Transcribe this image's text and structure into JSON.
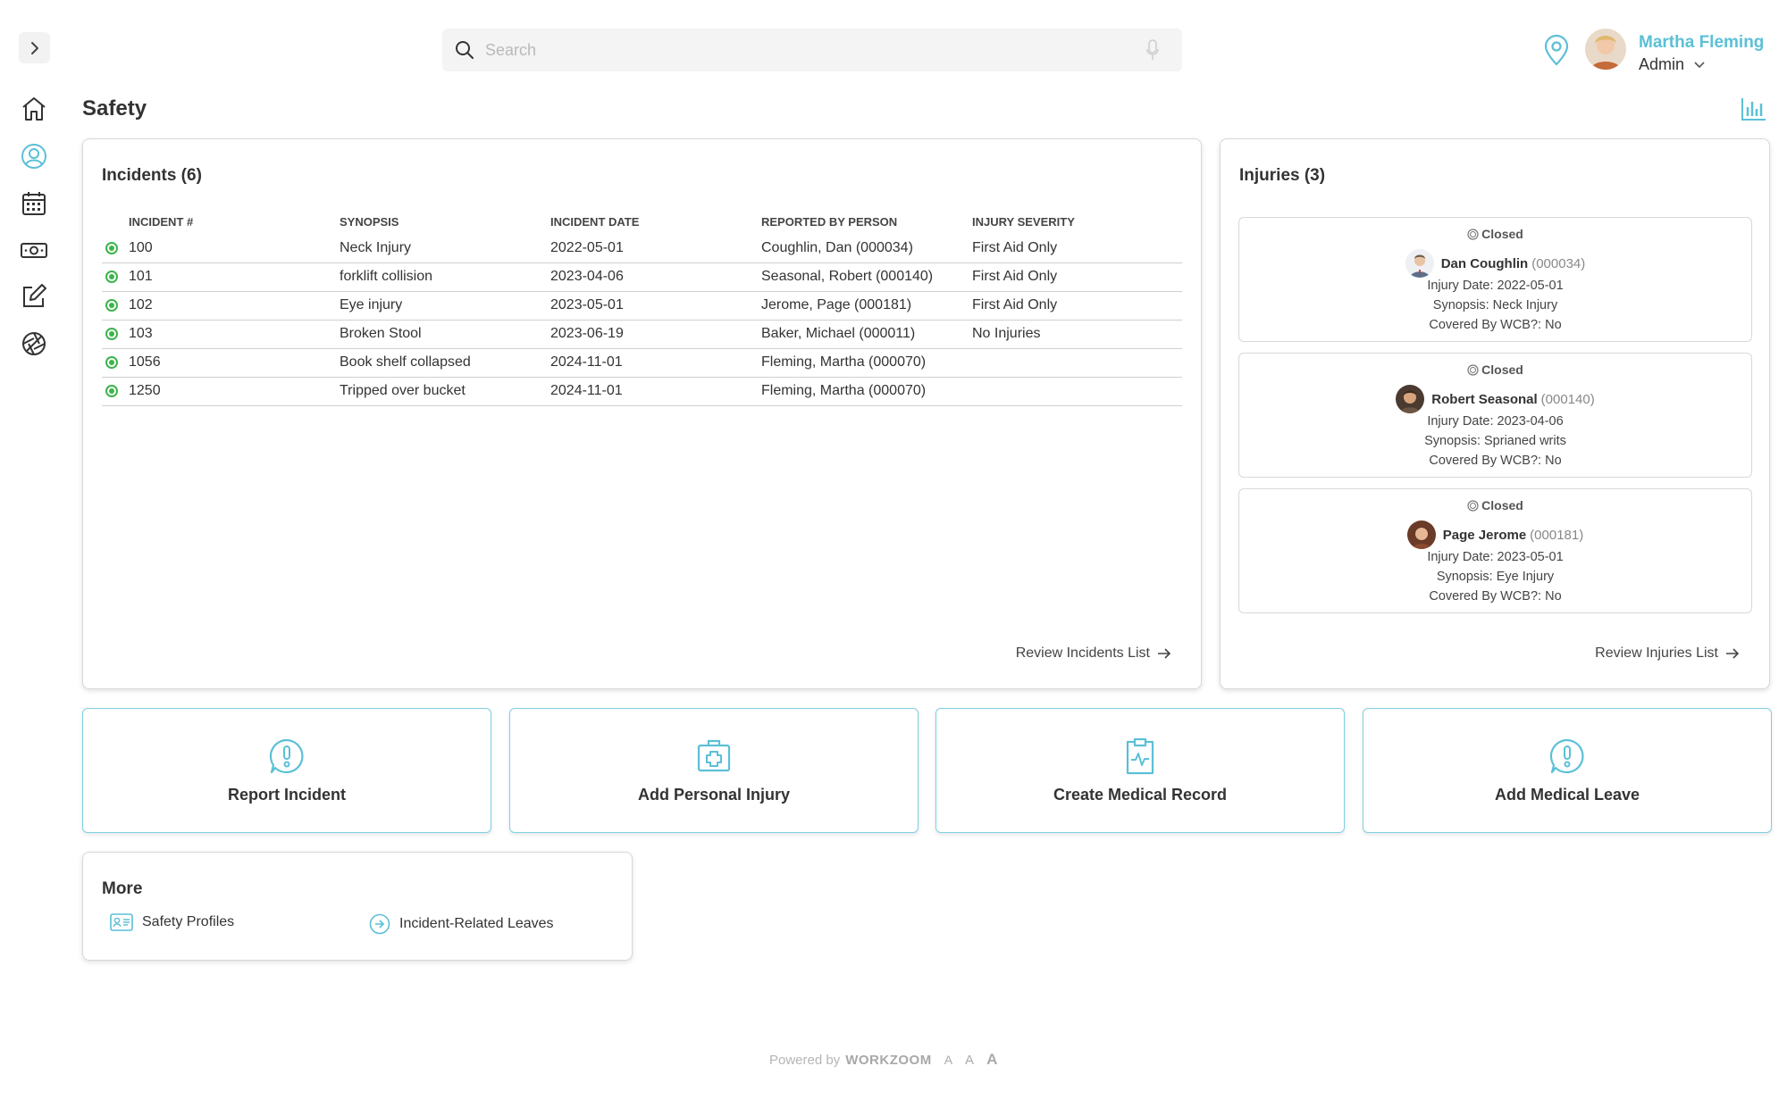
{
  "header": {
    "search_placeholder": "Search",
    "user_name": "Martha Fleming",
    "user_role": "Admin"
  },
  "page": {
    "title": "Safety"
  },
  "incidents": {
    "title": "Incidents (6)",
    "columns": [
      "INCIDENT #",
      "SYNOPSIS",
      "INCIDENT DATE",
      "REPORTED BY PERSON",
      "INJURY SEVERITY"
    ],
    "rows": [
      {
        "num": "100",
        "synopsis": "Neck Injury",
        "date": "2022-05-01",
        "reporter": "Coughlin, Dan (000034)",
        "severity": "First Aid Only"
      },
      {
        "num": "101",
        "synopsis": "forklift collision",
        "date": "2023-04-06",
        "reporter": "Seasonal, Robert (000140)",
        "severity": "First Aid Only"
      },
      {
        "num": "102",
        "synopsis": "Eye injury",
        "date": "2023-05-01",
        "reporter": "Jerome, Page (000181)",
        "severity": "First Aid Only"
      },
      {
        "num": "103",
        "synopsis": "Broken Stool",
        "date": "2023-06-19",
        "reporter": "Baker, Michael (000011)",
        "severity": "No Injuries"
      },
      {
        "num": "1056",
        "synopsis": "Book shelf collapsed",
        "date": "2024-11-01",
        "reporter": "Fleming, Martha (000070)",
        "severity": ""
      },
      {
        "num": "1250",
        "synopsis": "Tripped over bucket",
        "date": "2024-11-01",
        "reporter": "Fleming, Martha (000070)",
        "severity": ""
      }
    ],
    "review_link": "Review Incidents List"
  },
  "injuries": {
    "title": "Injuries (3)",
    "cards": [
      {
        "status": "Closed",
        "name": "Dan Coughlin",
        "id": "(000034)",
        "date": "Injury Date: 2022-05-01",
        "synopsis": "Synopsis: Neck Injury",
        "wcb": "Covered By WCB?: No"
      },
      {
        "status": "Closed",
        "name": "Robert Seasonal",
        "id": "(000140)",
        "date": "Injury Date: 2023-04-06",
        "synopsis": "Synopsis: Sprianed writs",
        "wcb": "Covered By WCB?: No"
      },
      {
        "status": "Closed",
        "name": "Page Jerome",
        "id": "(000181)",
        "date": "Injury Date: 2023-05-01",
        "synopsis": "Synopsis: Eye Injury",
        "wcb": "Covered By WCB?: No"
      }
    ],
    "review_link": "Review Injuries List"
  },
  "actions": [
    {
      "label": "Report Incident",
      "icon": "alert-bubble-icon"
    },
    {
      "label": "Add Personal Injury",
      "icon": "first-aid-kit-icon"
    },
    {
      "label": "Create Medical Record",
      "icon": "clipboard-pulse-icon"
    },
    {
      "label": "Add Medical Leave",
      "icon": "alert-bubble-icon"
    }
  ],
  "more": {
    "title": "More",
    "items": [
      {
        "label": "Safety Profiles",
        "icon": "id-card-icon"
      },
      {
        "label": "Incident-Related Leaves",
        "icon": "arrow-circle-icon"
      }
    ]
  },
  "footer": {
    "powered_by": "Powered by",
    "brand": "WORKZOOM",
    "font_a1": "A",
    "font_a2": "A",
    "font_a3": "A"
  },
  "colors": {
    "accent": "#5bc0d6",
    "status_green": "#3bb54a",
    "border": "#d8d8d8"
  }
}
